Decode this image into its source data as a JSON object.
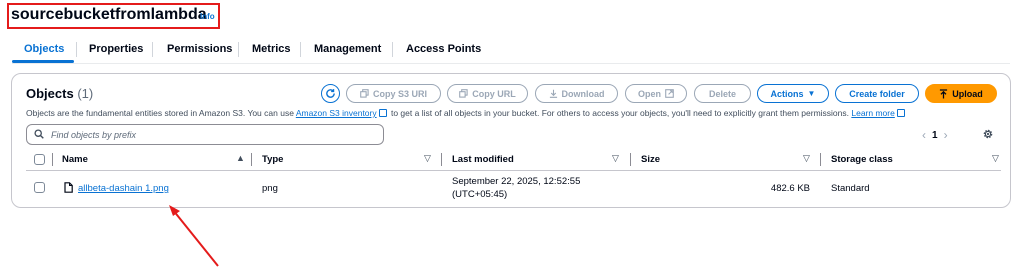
{
  "header": {
    "bucket_name": "sourcebucketfromlambda",
    "info_label": "Info"
  },
  "tabs": [
    {
      "label": "Objects",
      "active": true
    },
    {
      "label": "Properties",
      "active": false
    },
    {
      "label": "Permissions",
      "active": false
    },
    {
      "label": "Metrics",
      "active": false
    },
    {
      "label": "Management",
      "active": false
    },
    {
      "label": "Access Points",
      "active": false
    }
  ],
  "objects_panel": {
    "title": "Objects",
    "count": "(1)",
    "description_before": "Objects are the fundamental entities stored in Amazon S3. You can use ",
    "inventory_link": "Amazon S3 inventory",
    "description_after": " to get a list of all objects in your bucket. For others to access your objects, you'll need to explicitly grant them permissions. ",
    "learn_more": "Learn more"
  },
  "toolbar": {
    "copy_s3_uri": "Copy S3 URI",
    "copy_url": "Copy URL",
    "download": "Download",
    "open": "Open",
    "delete": "Delete",
    "actions": "Actions",
    "create_folder": "Create folder",
    "upload": "Upload"
  },
  "search": {
    "placeholder": "Find objects by prefix"
  },
  "pagination": {
    "current_page": "1"
  },
  "table": {
    "columns": [
      "Name",
      "Type",
      "Last modified",
      "Size",
      "Storage class"
    ],
    "rows": [
      {
        "name": "allbeta-dashain 1.png",
        "type": "png",
        "last_modified_line1": "September 22, 2025, 12:52:55",
        "last_modified_line2": "(UTC+05:45)",
        "size": "482.6 KB",
        "storage_class": "Standard"
      }
    ]
  },
  "colors": {
    "accent": "#0972d3",
    "primary_button": "#ff9900",
    "highlight": "#e41b1b"
  }
}
